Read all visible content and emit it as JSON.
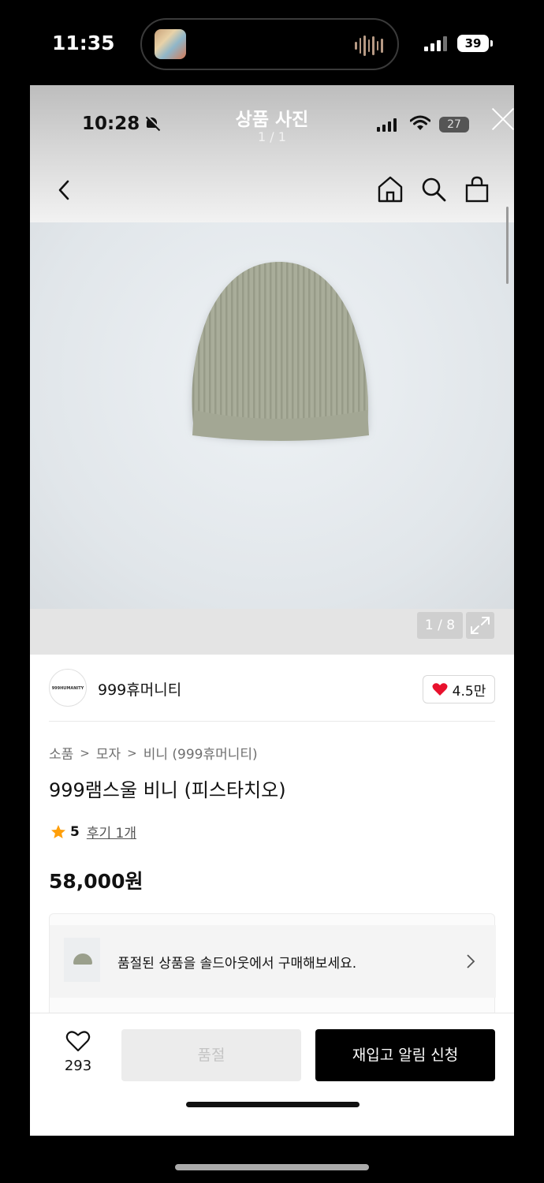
{
  "outer_status": {
    "time": "11:35",
    "battery": "39"
  },
  "viewer": {
    "title": "상품 사진",
    "count": "1 / 1"
  },
  "inner_status": {
    "time": "10:28",
    "battery": "27"
  },
  "gallery": {
    "counter": "1 / 8"
  },
  "brand": {
    "logo_text": "999HUMANITY",
    "name": "999휴머니티",
    "likes": "4.5만"
  },
  "breadcrumb": {
    "items": [
      "소품",
      "모자",
      "비니 (999휴머니티)"
    ],
    "separator": ">"
  },
  "product": {
    "title": "999램스울 비니 (피스타치오)",
    "rating": "5",
    "reviews": "후기 1개",
    "price": "58,000원"
  },
  "soldout_banner": {
    "text": "품절된 상품을 솔드아웃에서 구매해보세요."
  },
  "bottom_bar": {
    "wish_count": "293",
    "soldout_label": "품절",
    "restock_label": "재입고 알림 신청"
  },
  "colors": {
    "accent": "#000000",
    "heart": "#e8112d",
    "star": "#ff9f0a"
  }
}
